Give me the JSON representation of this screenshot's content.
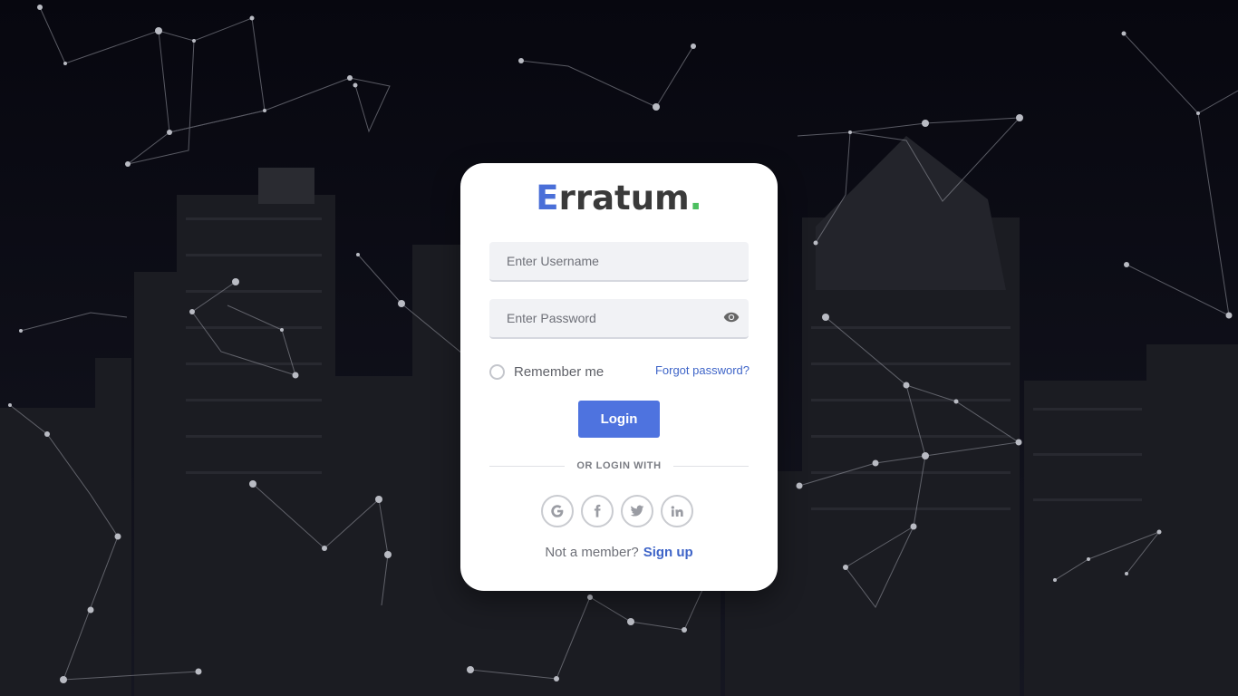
{
  "brand": {
    "first_letter": "E",
    "rest": "rratum",
    "dot": ".",
    "accent": "#4a6fd8",
    "dot_color": "#4cbf5f"
  },
  "form": {
    "username_placeholder": "Enter Username",
    "password_placeholder": "Enter Password",
    "remember_label": "Remember me",
    "forgot_label": "Forgot password?",
    "login_label": "Login"
  },
  "divider_text": "OR LOGIN WITH",
  "socials": [
    {
      "name": "google-icon",
      "glyph": "G"
    },
    {
      "name": "facebook-icon",
      "glyph": "f"
    },
    {
      "name": "twitter-icon",
      "glyph": "twitter"
    },
    {
      "name": "linkedin-icon",
      "glyph": "in"
    }
  ],
  "signup": {
    "prompt": "Not a member?",
    "link": "Sign up"
  },
  "colors": {
    "primary": "#4e73df",
    "link": "#3f65c8",
    "background": "#0a0b16"
  }
}
